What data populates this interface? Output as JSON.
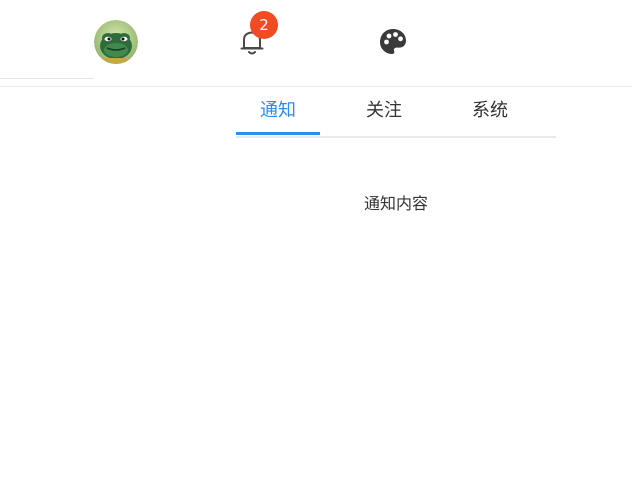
{
  "header": {
    "avatar_icon": "avatar-frog-icon",
    "notifications": {
      "icon": "bell-icon",
      "badge_count": "2",
      "badge_color": "#f04b22"
    },
    "theme_icon": "palette-icon"
  },
  "tabs": [
    {
      "label": "通知",
      "active": true
    },
    {
      "label": "关注",
      "active": false
    },
    {
      "label": "系统",
      "active": false
    }
  ],
  "colors": {
    "accent": "#2d8cf0",
    "text": "#333333"
  },
  "panel": {
    "content": "通知内容"
  }
}
